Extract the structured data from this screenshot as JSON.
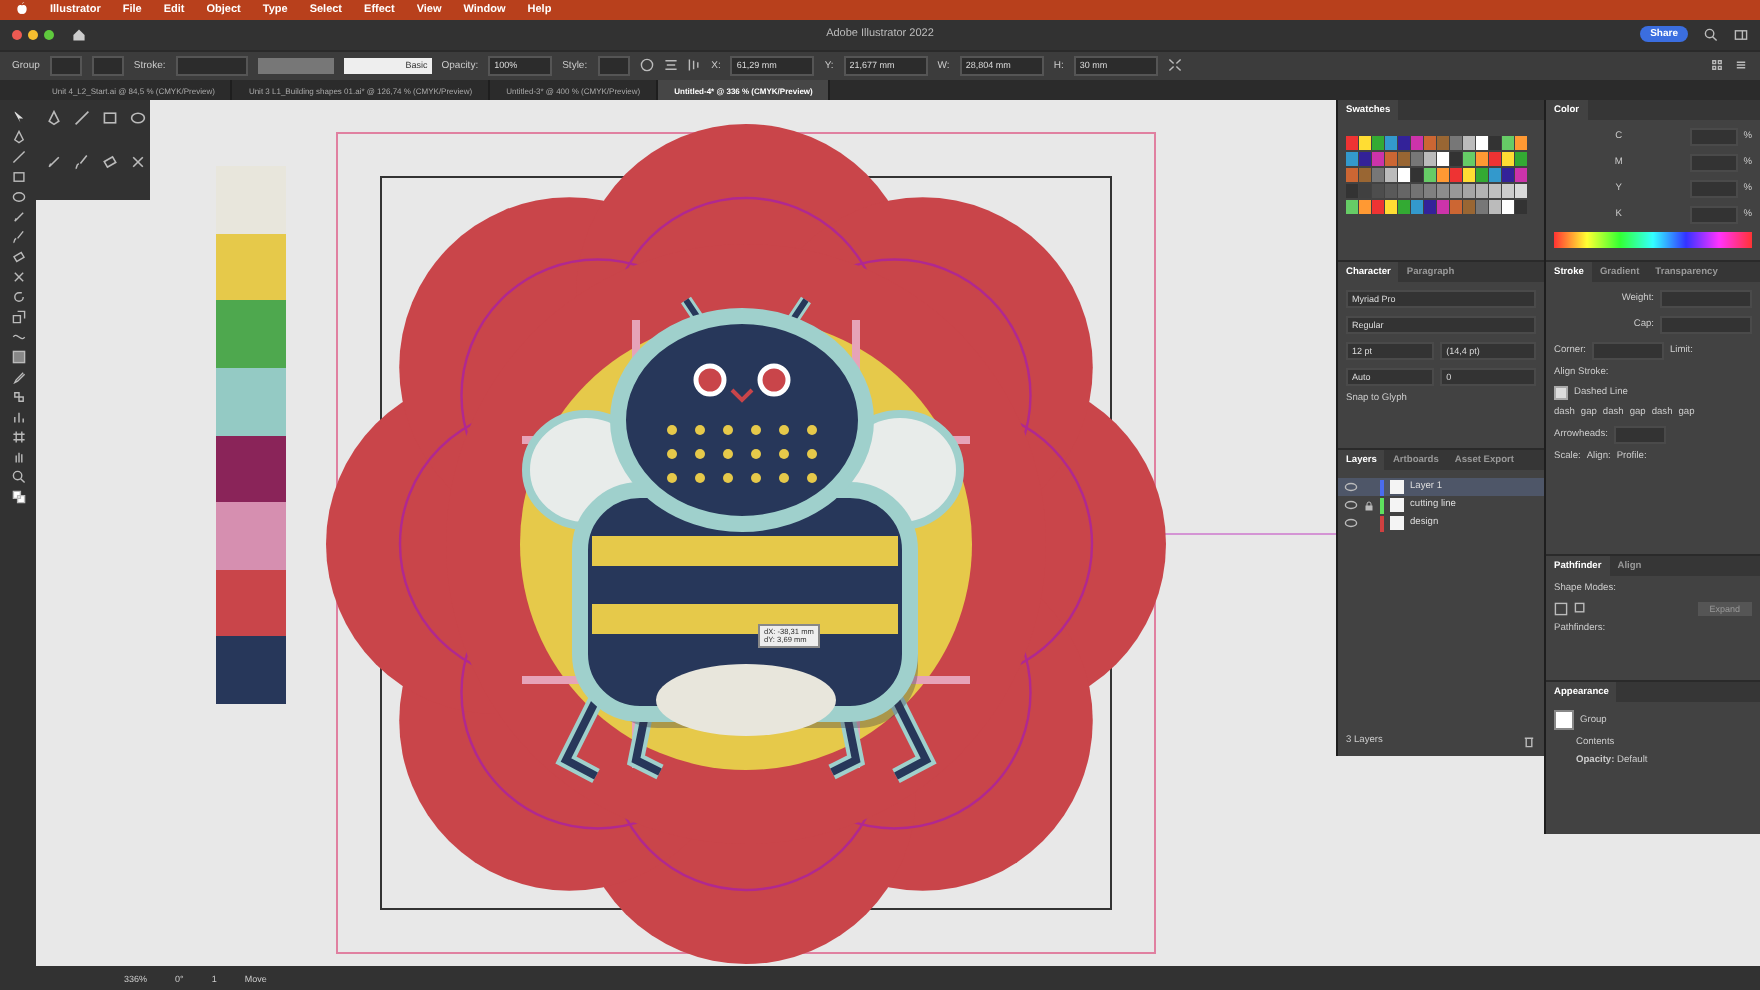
{
  "menu_bar": {
    "items": [
      "Illustrator",
      "File",
      "Edit",
      "Object",
      "Type",
      "Select",
      "Effect",
      "View",
      "Window",
      "Help"
    ]
  },
  "title_bar": {
    "title": "Adobe Illustrator 2022",
    "share": "Share"
  },
  "control_bar": {
    "selection": "Group",
    "stroke_label": "Stroke:",
    "brush": "Basic",
    "opacity_label": "Opacity:",
    "opacity": "100%",
    "style_label": "Style:",
    "fields": [
      {
        "label": "X:",
        "value": "61,29 mm"
      },
      {
        "label": "Y:",
        "value": "21,677 mm"
      },
      {
        "label": "W:",
        "value": "28,804 mm"
      },
      {
        "label": "H:",
        "value": "30 mm"
      }
    ]
  },
  "document_tabs": [
    {
      "label": "Unit 4_L2_Start.ai @ 84,5 % (CMYK/Preview)",
      "selected": false
    },
    {
      "label": "Unit 3 L1_Building shapes 01.ai* @ 126,74 % (CMYK/Preview)",
      "selected": false
    },
    {
      "label": "Untitled-3* @ 400 % (CMYK/Preview)",
      "selected": false
    },
    {
      "label": "Untitled-4* @ 336 % (CMYK/Preview)",
      "selected": true
    }
  ],
  "swatch_strip": [
    {
      "color": "#e8e6dc"
    },
    {
      "color": "#e6c94a"
    },
    {
      "color": "#4ea84e"
    },
    {
      "color": "#94cac4"
    },
    {
      "color": "#8a2459"
    },
    {
      "color": "#d68fb0"
    },
    {
      "color": "#c9454a"
    },
    {
      "color": "#27375a"
    }
  ],
  "tooltip": {
    "lines": [
      "dX: -38,31 mm",
      "dY: 3,69 mm"
    ]
  },
  "panels": {
    "swatches": {
      "tabs": [
        {
          "label": "Swatches",
          "selected": true
        }
      ]
    },
    "character": {
      "tabs": [
        {
          "label": "Character",
          "selected": true
        },
        {
          "label": "Paragraph",
          "selected": false
        }
      ],
      "font": "Myriad Pro",
      "style": "Regular",
      "size": "12 pt",
      "leading": "(14,4 pt)",
      "kerning": "Auto",
      "tracking": "0",
      "snap": "Snap to Glyph"
    },
    "layers": {
      "tabs": [
        {
          "label": "Layers",
          "selected": true
        },
        {
          "label": "Artboards",
          "selected": false
        },
        {
          "label": "Asset Export",
          "selected": false
        }
      ],
      "layers": [
        {
          "name": "Layer 1",
          "color": "#4a6cf0",
          "selected": true,
          "locked": false
        },
        {
          "name": "cutting line",
          "color": "#5ee05e",
          "selected": false,
          "locked": true
        },
        {
          "name": "design",
          "color": "#d04040",
          "selected": false,
          "locked": false
        }
      ],
      "count": "3 Layers"
    },
    "color": {
      "tabs": [
        {
          "label": "Color",
          "selected": true
        }
      ],
      "channels": [
        {
          "label": "C",
          "unit": "%"
        },
        {
          "label": "M",
          "unit": "%"
        },
        {
          "label": "Y",
          "unit": "%"
        },
        {
          "label": "K",
          "unit": "%"
        }
      ]
    },
    "stroke": {
      "tabs": [
        {
          "label": "Stroke",
          "selected": true
        },
        {
          "label": "Gradient",
          "selected": false
        },
        {
          "label": "Transparency",
          "selected": false
        }
      ],
      "weight": "Weight:",
      "cap": "Cap:",
      "corner": "Corner:",
      "limit": "Limit:",
      "align_stroke": "Align Stroke:",
      "dashed_line": {
        "label": "Dashed Line",
        "checked": false
      },
      "dash_labels": [
        "dash",
        "gap",
        "dash",
        "gap",
        "dash",
        "gap"
      ],
      "arrowheads": "Arrowheads:",
      "scale": "Scale:",
      "align": "Align:",
      "profile": "Profile:"
    },
    "pathfinder": {
      "tabs": [
        {
          "label": "Pathfinder",
          "selected": true
        },
        {
          "label": "Align",
          "selected": false
        }
      ],
      "shape_modes": "Shape Modes:",
      "expand": "Expand",
      "pathfinders": "Pathfinders:"
    },
    "appearance": {
      "tabs": [
        {
          "label": "Appearance",
          "selected": true
        }
      ],
      "rows": [
        "Group",
        "Contents"
      ],
      "opacity": "**Opacity:** Default"
    }
  },
  "status_bar": {
    "zoom": "336%",
    "rotation": "0°",
    "artboard": "1",
    "tool": "Move"
  }
}
